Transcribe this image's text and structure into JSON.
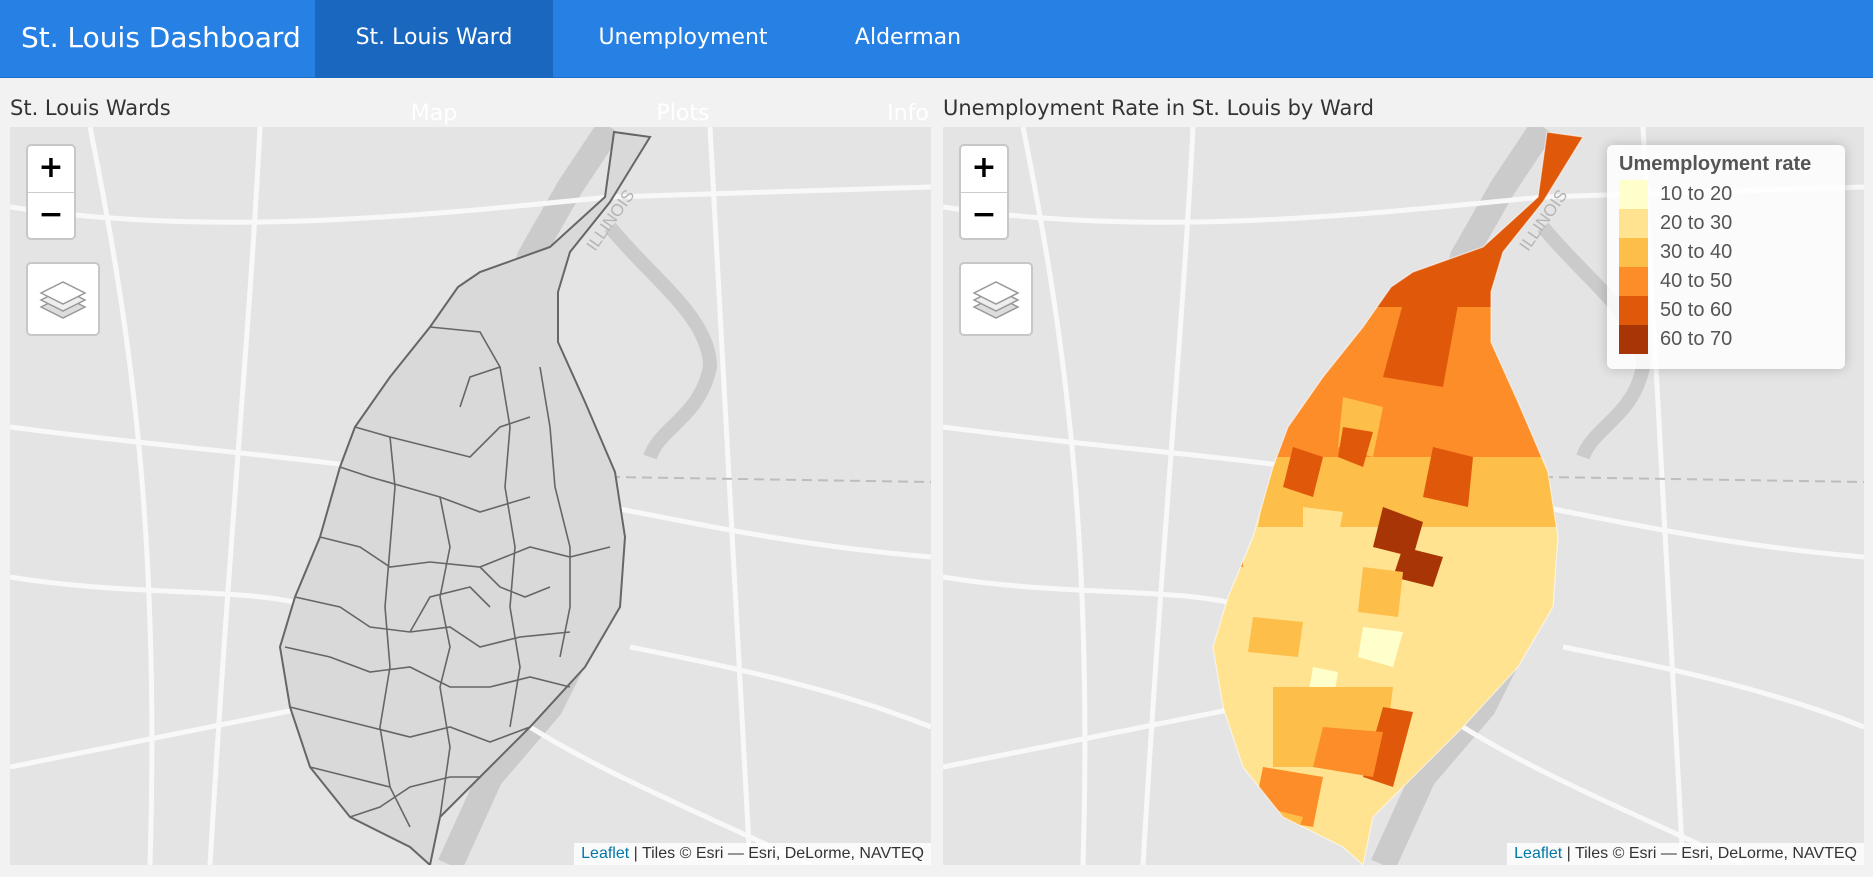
{
  "navbar": {
    "brand": "St. Louis Dashboard",
    "tabs": [
      {
        "label": "St. Louis Ward Map",
        "active": true
      },
      {
        "label": "Unemployment Plots",
        "active": false
      },
      {
        "label": "Alderman Info",
        "active": false
      }
    ]
  },
  "left_panel": {
    "title": "St. Louis Wards",
    "map": {
      "zoom_in": "+",
      "zoom_out": "−",
      "map_label": "ILLINOIS",
      "layers_icon": "layers-icon",
      "attribution_link": "Leaflet",
      "attribution_text": " | Tiles © Esri — Esri, DeLorme, NAVTEQ"
    }
  },
  "right_panel": {
    "title": "Unemployment Rate in St. Louis by Ward",
    "map": {
      "zoom_in": "+",
      "zoom_out": "−",
      "map_label": "ILLINOIS",
      "layers_icon": "layers-icon",
      "attribution_link": "Leaflet",
      "attribution_text": " | Tiles © Esri — Esri, DeLorme, NAVTEQ"
    },
    "legend": {
      "title": "Umemployment rate",
      "items": [
        {
          "label": "10 to 20",
          "color": "#ffffcc"
        },
        {
          "label": "20 to 30",
          "color": "#ffe391"
        },
        {
          "label": "30 to 40",
          "color": "#febe4a"
        },
        {
          "label": "40 to 50",
          "color": "#fd8d28"
        },
        {
          "label": "50 to 60",
          "color": "#e0590a"
        },
        {
          "label": "60 to 70",
          "color": "#a83505"
        }
      ]
    }
  },
  "colors": {
    "navbar": "#2780e3",
    "navbar_active": "#1967be",
    "ward_fill": "#d9d9d9",
    "ward_stroke": "#666666"
  }
}
